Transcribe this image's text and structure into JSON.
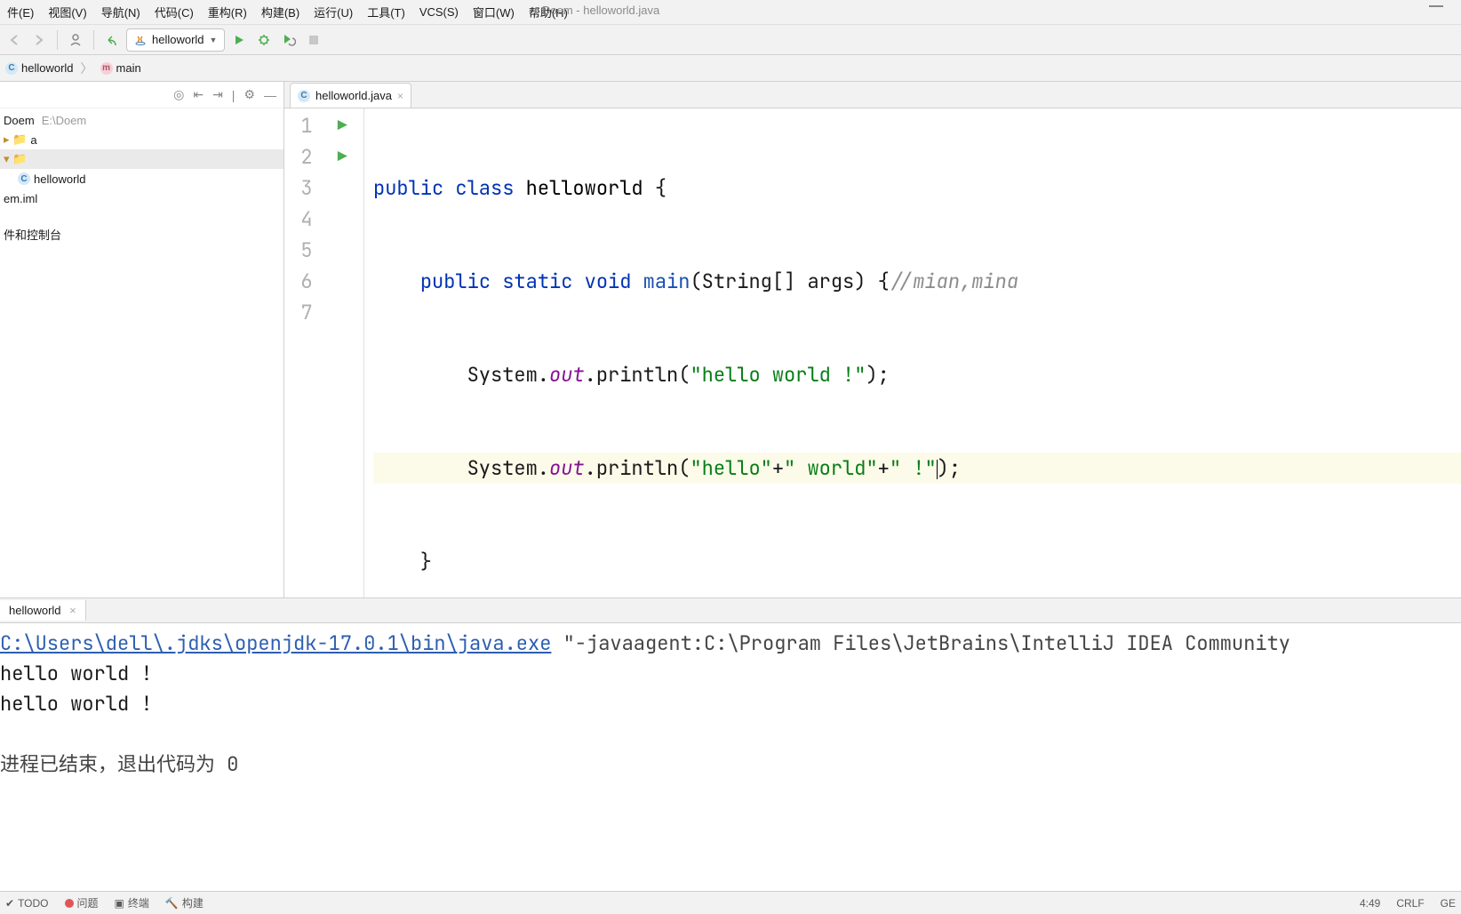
{
  "window": {
    "title": "Doem - helloworld.java"
  },
  "menu": {
    "file": "件(E)",
    "view": "视图(V)",
    "navigate": "导航(N)",
    "code": "代码(C)",
    "refactor": "重构(R)",
    "build": "构建(B)",
    "run": "运行(U)",
    "tools": "工具(T)",
    "vcs": "VCS(S)",
    "window": "窗口(W)",
    "help": "帮助(H)"
  },
  "toolbar": {
    "run_config_label": "helloworld"
  },
  "breadcrumb": {
    "class_icon": "C",
    "class_name": "helloworld",
    "method_icon": "m",
    "method_name": "main"
  },
  "project_tree": {
    "root_label": "Doem",
    "root_path": "E:\\Doem",
    "nodes": [
      {
        "label": "a"
      },
      {
        "label": "",
        "selected": true
      },
      {
        "label": "helloworld"
      },
      {
        "label": "em.iml"
      },
      {
        "label": "件和控制台"
      }
    ]
  },
  "editor": {
    "tab_icon": "C",
    "tab_label": "helloworld.java",
    "lines": {
      "count": 7,
      "l1_kw_public": "public",
      "l1_kw_class": "class",
      "l1_ident": "helloworld",
      "l1_brace": " {",
      "l2_kw_public": "public",
      "l2_kw_static": "static",
      "l2_kw_void": "void",
      "l2_meth": "main",
      "l2_params": "(String[] args) {",
      "l2_comment": "//mian,mina",
      "l3_pre": "System.",
      "l3_out": "out",
      "l3_print": ".println(",
      "l3_str": "\"hello world !\"",
      "l3_end": ");",
      "l4_pre": "System.",
      "l4_out": "out",
      "l4_print": ".println(",
      "l4_str1": "\"hello\"",
      "l4_plus1": "+",
      "l4_str2": "\" world\"",
      "l4_plus2": "+",
      "l4_str3": "\" !\"",
      "l4_end": ");",
      "l5_brace": "    }",
      "l6_brace": "}"
    },
    "caret": {
      "line": 4,
      "col": 49
    }
  },
  "console": {
    "tab_label": "helloworld",
    "exe_path": "C:\\Users\\dell\\.jdks\\openjdk-17.0.1\\bin\\java.exe",
    "args": " \"-javaagent:C:\\Program Files\\JetBrains\\IntelliJ IDEA Community",
    "out1": "hello world !",
    "out2": "hello world !",
    "exit_msg": "进程已结束，退出代码为 0"
  },
  "bottom": {
    "todo": "TODO",
    "problems": "问题",
    "terminal": "终端",
    "build": "构建"
  },
  "status": {
    "cursor": "4:49",
    "eol": "CRLF",
    "enc": "GE"
  }
}
